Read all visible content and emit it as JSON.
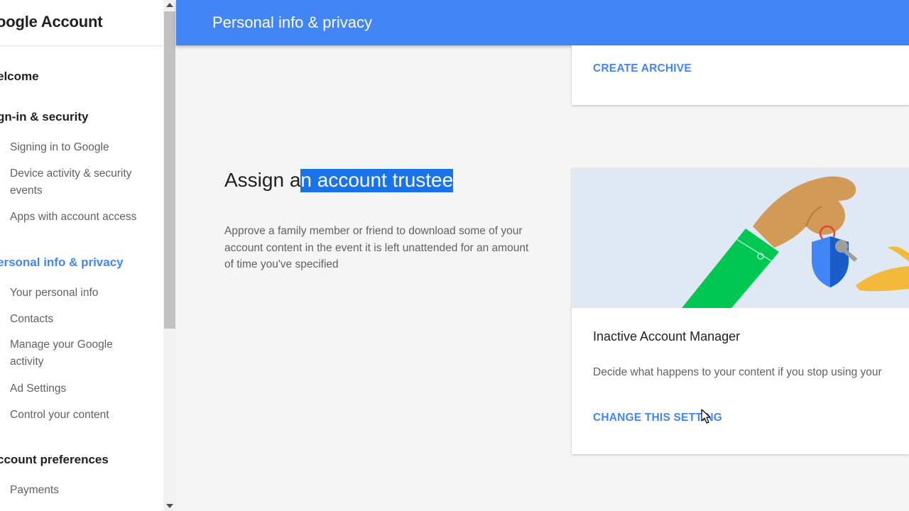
{
  "sidebar": {
    "title": "oogle Account",
    "sections": [
      {
        "label": "elcome"
      },
      {
        "label": "gn-in & security",
        "items": [
          "Signing in to Google",
          "Device activity & security events",
          "Apps with account access"
        ]
      },
      {
        "label": "ersonal info & privacy",
        "items": [
          "Your personal info",
          "Contacts",
          "Manage your Google activity",
          "Ad Settings",
          "Control your content"
        ]
      },
      {
        "label": "ccount preferences",
        "items": [
          "Payments"
        ]
      }
    ]
  },
  "header": {
    "title": "Personal info & privacy"
  },
  "top_card": {
    "action_label": "CREATE ARCHIVE"
  },
  "section": {
    "heading_plain": "Assign a",
    "heading_selected": "n account trustee",
    "description": "Approve a family member or friend to download some of your account content in the event it is left unattended for an amount of time you've specified"
  },
  "card": {
    "name": "Inactive Account Manager",
    "description": "Decide what happens to your content if you stop using your",
    "action_label": "CHANGE THIS SETTING"
  },
  "colors": {
    "accent": "#4285f4",
    "selection": "#1a73e8",
    "illustration_bg": "#dfe8f3",
    "sleeve": "#00c853",
    "shield": "#4285f4"
  }
}
